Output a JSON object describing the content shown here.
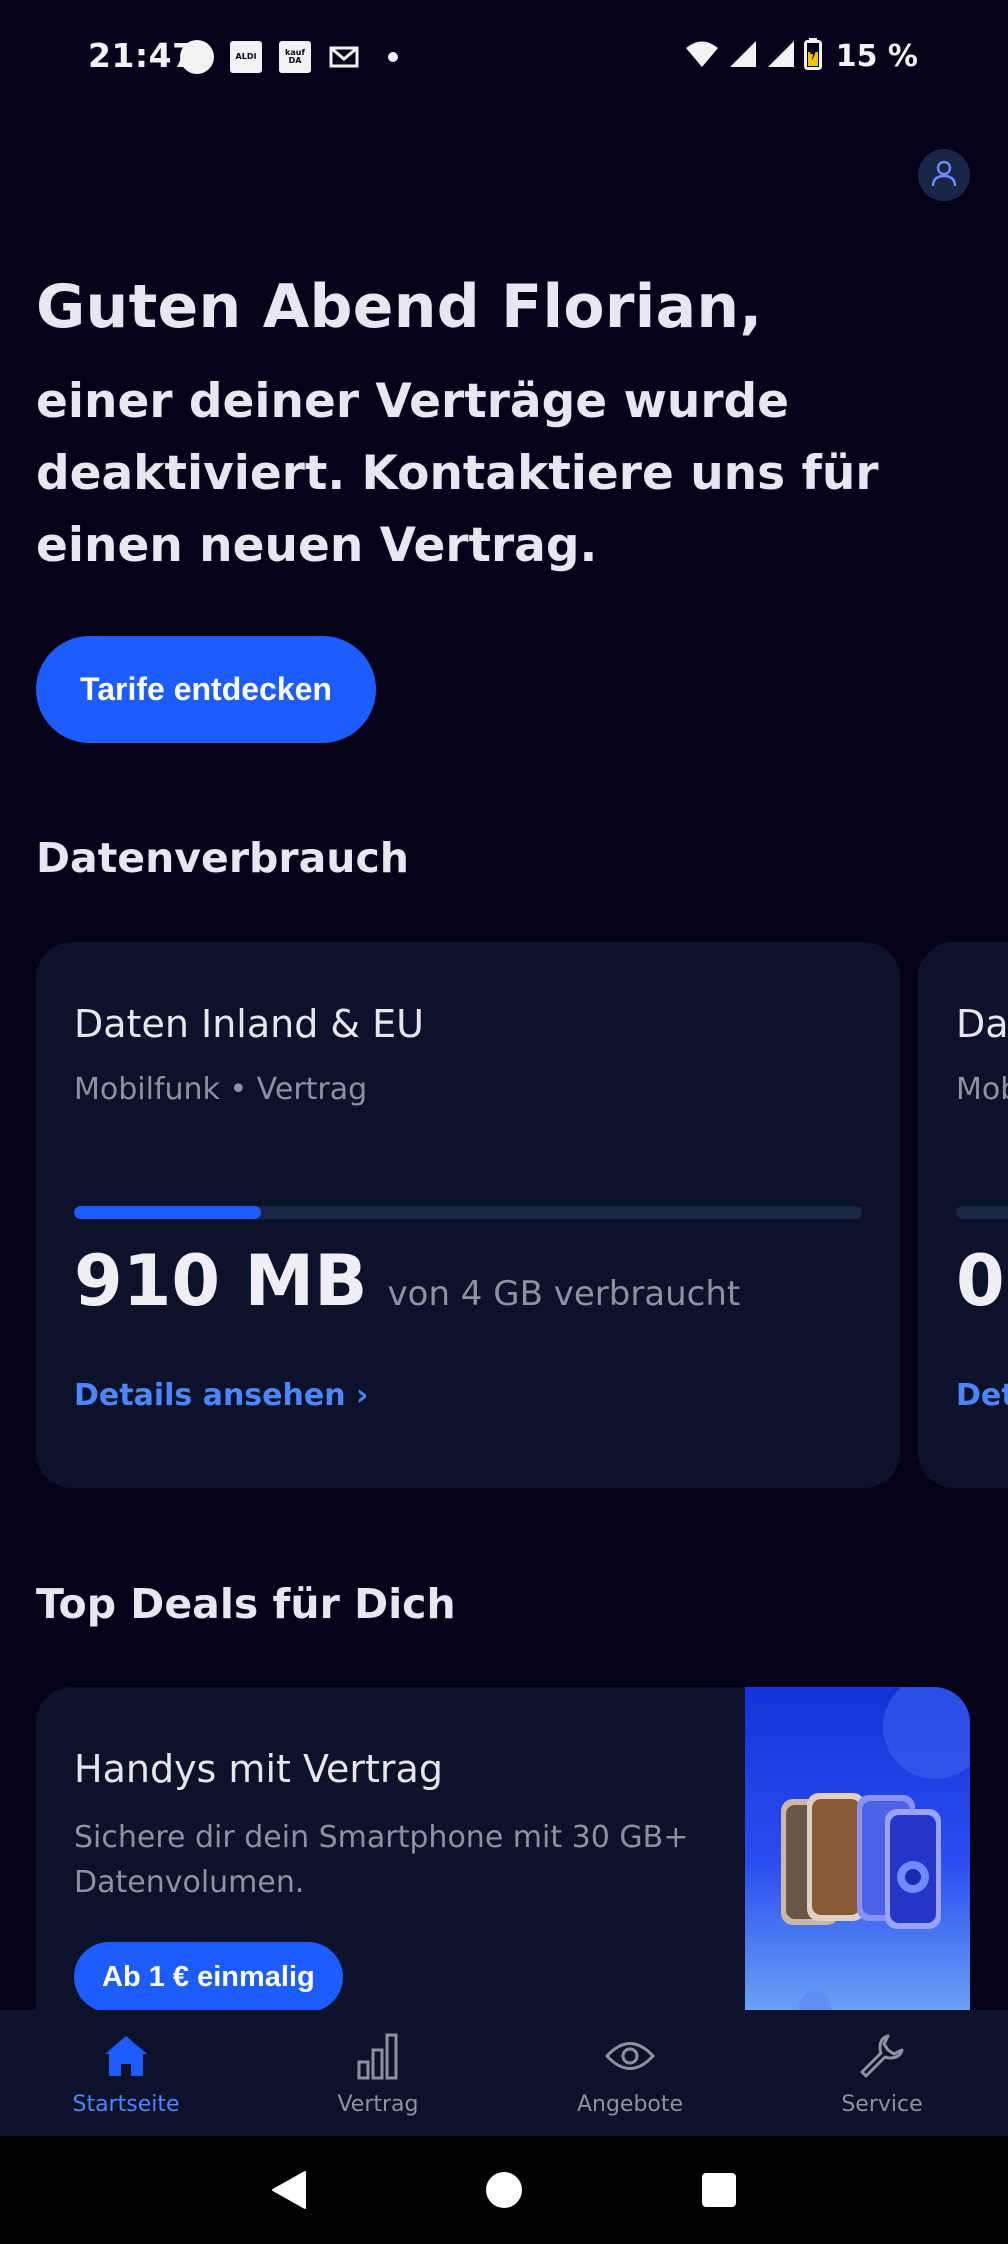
{
  "status_bar": {
    "time": "21:47",
    "notifications": [
      "circle-icon",
      "aldi-icon",
      "kaufda-icon",
      "mail-icon",
      "dot-icon"
    ],
    "aldi_label": "ALDI",
    "kaufda_label": "kauf DA",
    "battery_percent": "15 %"
  },
  "header": {
    "profile_icon": "user-icon"
  },
  "greeting": {
    "title": "Guten Abend Florian,",
    "message": "einer deiner Verträge wurde deaktiviert. Kontaktiere uns für einen neuen Vertrag.",
    "cta_label": "Tarife entdecken"
  },
  "data_usage": {
    "section_title": "Datenverbrauch",
    "cards": [
      {
        "title": "Daten Inland & EU",
        "subtitle": "Mobilfunk • Vertrag",
        "used": "910 MB",
        "of_text": "von 4 GB verbraucht",
        "progress_fraction": 0.2375,
        "link_label": "Details ansehen ›"
      },
      {
        "title": "Da",
        "subtitle": "Mob",
        "used": "0",
        "link_label": "Det"
      }
    ]
  },
  "deals": {
    "section_title": "Top Deals für Dich",
    "card": {
      "title": "Handys mit Vertrag",
      "description": "Sichere dir dein Smartphone mit 30 GB+ Datenvolumen.",
      "button_label": "Ab 1 € einmalig"
    }
  },
  "bottom_nav": {
    "items": [
      {
        "label": "Startseite",
        "icon": "home-icon",
        "active": true
      },
      {
        "label": "Vertrag",
        "icon": "bar-chart-icon",
        "active": false
      },
      {
        "label": "Angebote",
        "icon": "eye-icon",
        "active": false
      },
      {
        "label": "Service",
        "icon": "wrench-icon",
        "active": false
      }
    ]
  },
  "colors": {
    "background": "#04031a",
    "card": "#0c1229",
    "accent": "#1d5cff",
    "link": "#4c86ff",
    "muted_text": "#8d91a3"
  }
}
